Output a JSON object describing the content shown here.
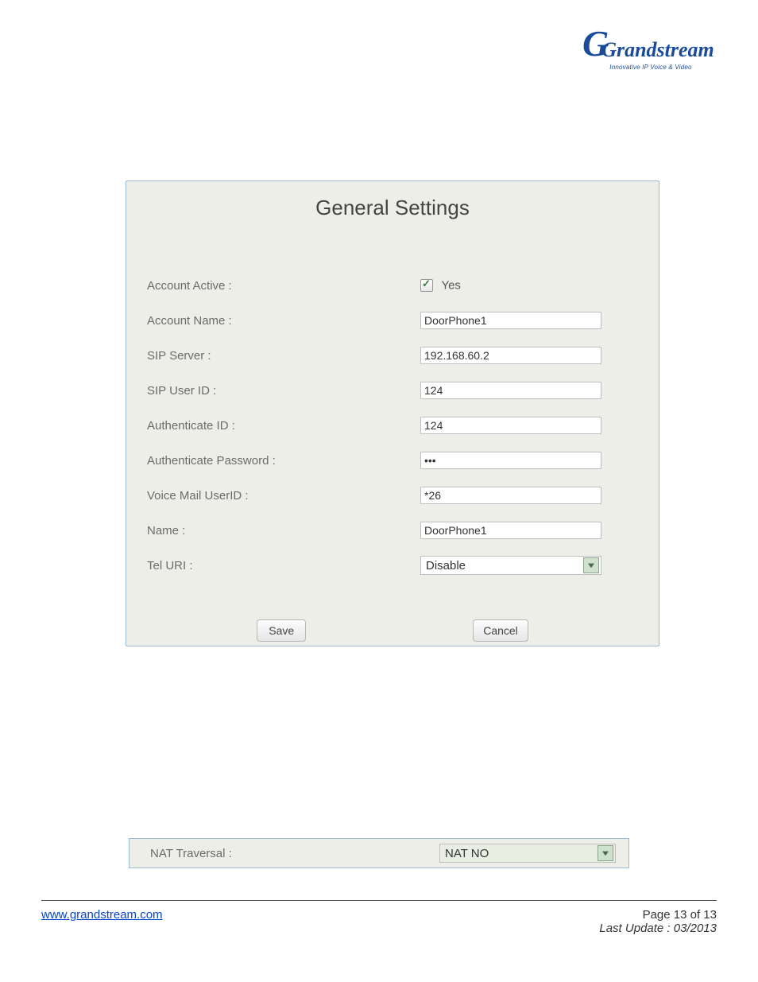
{
  "brand": {
    "name": "Grandstream",
    "tagline": "Innovative IP Voice & Video"
  },
  "panel": {
    "title": "General Settings",
    "fields": {
      "account_active": {
        "label": "Account Active :",
        "checkbox_label": "Yes",
        "checked": true
      },
      "account_name": {
        "label": "Account Name :",
        "value": "DoorPhone1"
      },
      "sip_server": {
        "label": "SIP Server :",
        "value": "192.168.60.2"
      },
      "sip_user_id": {
        "label": "SIP User ID :",
        "value": "124"
      },
      "auth_id": {
        "label": "Authenticate ID :",
        "value": "124"
      },
      "auth_password": {
        "label": "Authenticate Password :",
        "value": "•••"
      },
      "voice_mail": {
        "label": "Voice Mail UserID :",
        "value": "*26"
      },
      "name": {
        "label": "Name :",
        "value": "DoorPhone1"
      },
      "tel_uri": {
        "label": "Tel URI :",
        "value": "Disable"
      }
    },
    "buttons": {
      "save": "Save",
      "cancel": "Cancel"
    }
  },
  "nat": {
    "label": "NAT Traversal :",
    "value": "NAT NO"
  },
  "footer": {
    "url": "www.grandstream.com",
    "page": "Page 13 of 13",
    "last_update": "Last Update : 03/2013"
  }
}
